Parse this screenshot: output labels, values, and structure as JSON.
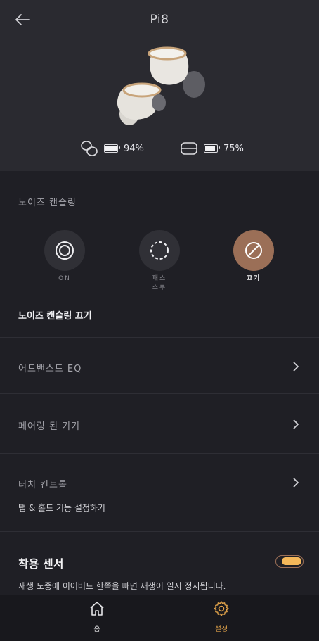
{
  "header": {
    "title": "Pi8",
    "earbud_battery": "94%",
    "case_battery": "75%",
    "earbud_battery_fraction": 0.94,
    "case_battery_fraction": 0.75
  },
  "noise_cancelling": {
    "section_label": "노이즈 캔슬링",
    "modes": [
      {
        "label": "ON",
        "active": false
      },
      {
        "label_line1": "패스",
        "label_line2": "스루",
        "active": false
      },
      {
        "label": "끄기",
        "active": true
      }
    ],
    "status_text": "노이즈 캔슬링 끄기"
  },
  "menu": {
    "advanced_eq": "어드밴스드 EQ",
    "paired_devices": "페어링 된 기기",
    "touch_controls": "터치 컨트롤",
    "touch_controls_sub": "탭 & 홀드 기능 설정하기"
  },
  "wear_sensor": {
    "title": "착용 센서",
    "description": "재생 도중에 이어버드 한쪽을 빼면 재생이 일시 정지됩니다.",
    "enabled": true
  },
  "bottom_nav": {
    "home_label": "홈",
    "settings_label": "설정"
  },
  "colors": {
    "accent": "#9b6f57",
    "toggle_on": "#f4b85a",
    "active_nav": "#e0a24a",
    "background": "#1f1f25",
    "header_background": "#2a2a30"
  },
  "icons": {
    "back": "arrow-left-icon",
    "earbuds_battery": "earbuds-icon",
    "case_battery": "case-icon",
    "mode_on": "nc-on-icon",
    "mode_passthrough": "passthrough-icon",
    "mode_off": "nc-off-icon",
    "chevron": "chevron-right-icon",
    "home": "home-icon",
    "settings": "gear-icon"
  }
}
